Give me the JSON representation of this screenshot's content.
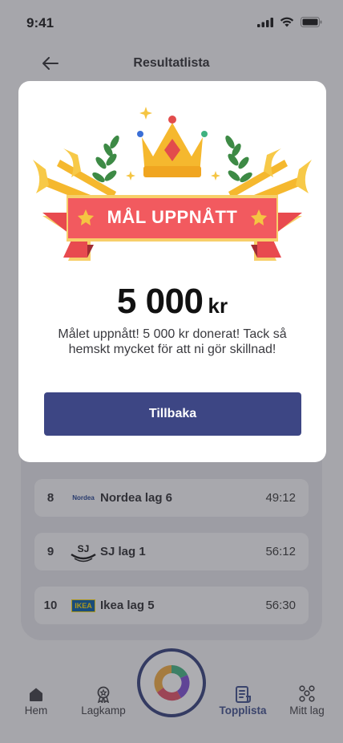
{
  "status_bar": {
    "time": "9:41"
  },
  "header": {
    "title": "Resultatlista"
  },
  "leaderboard": {
    "rows": [
      {
        "rank": "8",
        "logo": "Nordea",
        "team": "Nordea lag 6",
        "time": "49:12"
      },
      {
        "rank": "9",
        "logo": "SJ",
        "team": "SJ lag 1",
        "time": "56:12"
      },
      {
        "rank": "10",
        "logo": "IKEA",
        "team": "Ikea lag 5",
        "time": "56:30"
      }
    ]
  },
  "modal": {
    "badge_text": "MÅL UPPNÅTT",
    "amount": "5 000",
    "currency": "kr",
    "message": "Målet uppnått! 5 000 kr donerat! Tack så hemskt mycket för att ni gör skillnad!",
    "button_label": "Tillbaka"
  },
  "nav": {
    "items": [
      {
        "label": "Hem",
        "icon": "home-icon"
      },
      {
        "label": "Lagkamp",
        "icon": "medal-icon"
      },
      {
        "label": "Topplista",
        "icon": "leaderboard-icon"
      },
      {
        "label": "Mitt lag",
        "icon": "team-icon"
      }
    ],
    "active": "Topplista"
  },
  "colors": {
    "primary": "#3d4684",
    "ribbon": "#f25a5f",
    "gold": "#f5b82e",
    "laurel": "#3d8a45"
  }
}
